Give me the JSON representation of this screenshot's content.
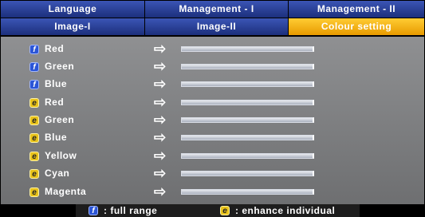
{
  "tabs_row1": [
    "Language",
    "Management - I",
    "Management - II"
  ],
  "tabs_row2": [
    "Image-I",
    "Image-II",
    "Colour setting"
  ],
  "active_tab": "Colour setting",
  "colors": {
    "tab_blue": "#2a3f95",
    "tab_active": "#f2b21a",
    "panel": "#808183"
  },
  "rows": [
    {
      "badge": "f",
      "label": "Red"
    },
    {
      "badge": "f",
      "label": "Green"
    },
    {
      "badge": "f",
      "label": "Blue"
    },
    {
      "badge": "e",
      "label": "Red"
    },
    {
      "badge": "e",
      "label": "Green"
    },
    {
      "badge": "e",
      "label": "Blue"
    },
    {
      "badge": "e",
      "label": "Yellow"
    },
    {
      "badge": "e",
      "label": "Cyan"
    },
    {
      "badge": "e",
      "label": "Magenta"
    }
  ],
  "arrow_icon": "right-arrow-icon",
  "legend": {
    "full_badge": "f",
    "full_text": ": full range",
    "enh_badge": "e",
    "enh_text": ": enhance individual"
  }
}
